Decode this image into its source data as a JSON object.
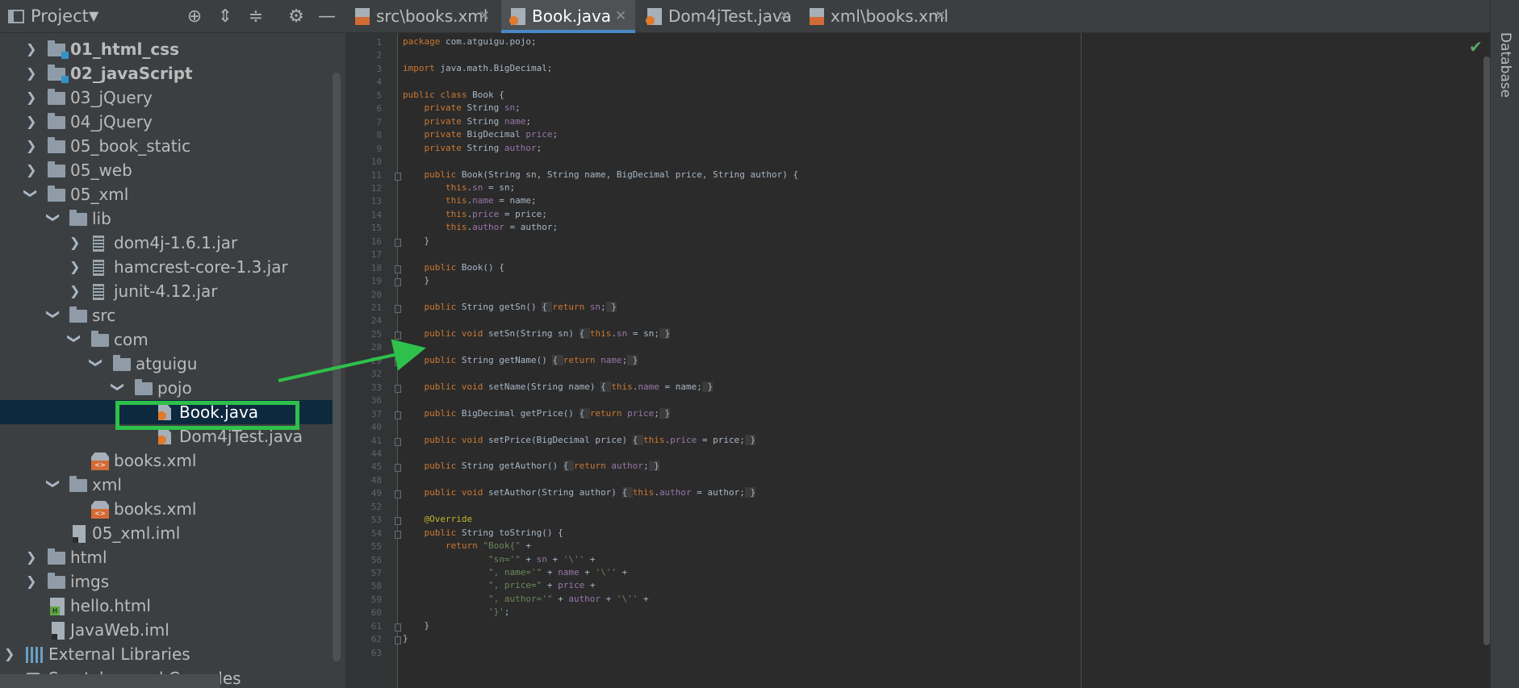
{
  "project_panel": {
    "title": "Project",
    "dropdown_glyph": "▼",
    "tools": [
      "locate-icon",
      "expand-all-icon",
      "collapse-all-icon",
      "gear-icon",
      "minimize-icon"
    ],
    "tree": [
      {
        "label": "01_html_css",
        "bold": true
      },
      {
        "label": "02_javaScript",
        "bold": true
      },
      {
        "label": "03_jQuery"
      },
      {
        "label": "04_jQuery"
      },
      {
        "label": "05_book_static"
      },
      {
        "label": "05_web"
      },
      {
        "label": "05_xml"
      },
      {
        "label": "lib"
      },
      {
        "label": "dom4j-1.6.1.jar"
      },
      {
        "label": "hamcrest-core-1.3.jar"
      },
      {
        "label": "junit-4.12.jar"
      },
      {
        "label": "src"
      },
      {
        "label": "com"
      },
      {
        "label": "atguigu"
      },
      {
        "label": "pojo"
      },
      {
        "label": "Book.java",
        "selected": true
      },
      {
        "label": "Dom4jTest.java"
      },
      {
        "label": "books.xml"
      },
      {
        "label": "xml"
      },
      {
        "label": "books.xml"
      },
      {
        "label": "05_xml.iml"
      },
      {
        "label": "html"
      },
      {
        "label": "imgs"
      },
      {
        "label": "hello.html"
      },
      {
        "label": "JavaWeb.iml"
      },
      {
        "label": "External Libraries"
      },
      {
        "label": "Scratches and Consoles"
      }
    ]
  },
  "tabs": [
    {
      "label": "src\\books.xml",
      "close": "✕"
    },
    {
      "label": "Book.java",
      "close": "✕",
      "active": true
    },
    {
      "label": "Dom4jTest.java",
      "close": "✕"
    },
    {
      "label": "xml\\books.xml",
      "close": "✕"
    }
  ],
  "right_strip": {
    "label": "Database"
  },
  "editor": {
    "status_icon": "✔",
    "line_numbers": [
      "1",
      "2",
      "3",
      "4",
      "5",
      "6",
      "7",
      "8",
      "9",
      "10",
      "11",
      "12",
      "13",
      "14",
      "15",
      "16",
      "17",
      "18",
      "19",
      "20",
      "21",
      "24",
      "25",
      "28",
      "29",
      "32",
      "33",
      "36",
      "37",
      "40",
      "41",
      "44",
      "45",
      "48",
      "49",
      "52",
      "53",
      "54",
      "55",
      "56",
      "57",
      "58",
      "59",
      "60",
      "61",
      "62",
      "63"
    ],
    "lines": [
      {
        "p": [
          [
            "kw",
            "package "
          ],
          [
            "",
            "com.atguigu.pojo;"
          ]
        ]
      },
      {
        "p": []
      },
      {
        "p": [
          [
            "kw",
            "import "
          ],
          [
            "",
            "java.math.BigDecimal;"
          ]
        ]
      },
      {
        "p": []
      },
      {
        "p": [
          [
            "kw",
            "public class "
          ],
          [
            "",
            "Book {"
          ]
        ]
      },
      {
        "p": [
          [
            "",
            "    "
          ],
          [
            "kw",
            "private "
          ],
          [
            "",
            "String "
          ],
          [
            "fld",
            "sn"
          ],
          [
            "",
            ";"
          ]
        ]
      },
      {
        "p": [
          [
            "",
            "    "
          ],
          [
            "kw",
            "private "
          ],
          [
            "",
            "String "
          ],
          [
            "fld",
            "name"
          ],
          [
            "",
            ";"
          ]
        ]
      },
      {
        "p": [
          [
            "",
            "    "
          ],
          [
            "kw",
            "private "
          ],
          [
            "",
            "BigDecimal "
          ],
          [
            "fld",
            "price"
          ],
          [
            "",
            ";"
          ]
        ]
      },
      {
        "p": [
          [
            "",
            "    "
          ],
          [
            "kw",
            "private "
          ],
          [
            "",
            "String "
          ],
          [
            "fld",
            "author"
          ],
          [
            "",
            ";"
          ]
        ]
      },
      {
        "p": []
      },
      {
        "p": [
          [
            "",
            "    "
          ],
          [
            "kw",
            "public "
          ],
          [
            "",
            "Book(String sn, String name, BigDecimal price, String author) {"
          ]
        ]
      },
      {
        "p": [
          [
            "",
            "        "
          ],
          [
            "kw",
            "this"
          ],
          [
            "",
            "."
          ],
          [
            "fld",
            "sn"
          ],
          [
            "",
            " = sn;"
          ]
        ]
      },
      {
        "p": [
          [
            "",
            "        "
          ],
          [
            "kw",
            "this"
          ],
          [
            "",
            "."
          ],
          [
            "fld",
            "name"
          ],
          [
            "",
            " = name;"
          ]
        ]
      },
      {
        "p": [
          [
            "",
            "        "
          ],
          [
            "kw",
            "this"
          ],
          [
            "",
            "."
          ],
          [
            "fld",
            "price"
          ],
          [
            "",
            " = price;"
          ]
        ]
      },
      {
        "p": [
          [
            "",
            "        "
          ],
          [
            "kw",
            "this"
          ],
          [
            "",
            "."
          ],
          [
            "fld",
            "author"
          ],
          [
            "",
            " = author;"
          ]
        ]
      },
      {
        "p": [
          [
            "",
            "    }"
          ]
        ]
      },
      {
        "p": []
      },
      {
        "p": [
          [
            "",
            "    "
          ],
          [
            "kw",
            "public "
          ],
          [
            "",
            "Book() {"
          ]
        ]
      },
      {
        "p": [
          [
            "",
            "    }"
          ]
        ]
      },
      {
        "p": []
      },
      {
        "p": [
          [
            "",
            "    "
          ],
          [
            "kw",
            "public "
          ],
          [
            "",
            "String getSn() "
          ],
          [
            "fold-bg",
            "{ "
          ],
          [
            "kw",
            "return "
          ],
          [
            "fld",
            "sn"
          ],
          [
            "",
            ";"
          ],
          [
            "fold-bg",
            " }"
          ]
        ]
      },
      {
        "p": []
      },
      {
        "p": [
          [
            "",
            "    "
          ],
          [
            "kw",
            "public void "
          ],
          [
            "",
            "setSn(String sn) "
          ],
          [
            "fold-bg",
            "{ "
          ],
          [
            "kw",
            "this"
          ],
          [
            "",
            "."
          ],
          [
            "fld",
            "sn"
          ],
          [
            "",
            " = sn;"
          ],
          [
            "fold-bg",
            " }"
          ]
        ]
      },
      {
        "p": []
      },
      {
        "p": [
          [
            "",
            "    "
          ],
          [
            "kw",
            "public "
          ],
          [
            "",
            "String getName() "
          ],
          [
            "fold-bg",
            "{ "
          ],
          [
            "kw",
            "return "
          ],
          [
            "fld",
            "name"
          ],
          [
            "",
            ";"
          ],
          [
            "fold-bg",
            " }"
          ]
        ]
      },
      {
        "p": []
      },
      {
        "p": [
          [
            "",
            "    "
          ],
          [
            "kw",
            "public void "
          ],
          [
            "",
            "setName(String name) "
          ],
          [
            "fold-bg",
            "{ "
          ],
          [
            "kw",
            "this"
          ],
          [
            "",
            "."
          ],
          [
            "fld",
            "name"
          ],
          [
            "",
            " = name;"
          ],
          [
            "fold-bg",
            " }"
          ]
        ]
      },
      {
        "p": []
      },
      {
        "p": [
          [
            "",
            "    "
          ],
          [
            "kw",
            "public "
          ],
          [
            "",
            "BigDecimal getPrice() "
          ],
          [
            "fold-bg",
            "{ "
          ],
          [
            "kw",
            "return "
          ],
          [
            "fld",
            "price"
          ],
          [
            "",
            ";"
          ],
          [
            "fold-bg",
            " }"
          ]
        ]
      },
      {
        "p": []
      },
      {
        "p": [
          [
            "",
            "    "
          ],
          [
            "kw",
            "public void "
          ],
          [
            "",
            "setPrice(BigDecimal price) "
          ],
          [
            "fold-bg",
            "{ "
          ],
          [
            "kw",
            "this"
          ],
          [
            "",
            "."
          ],
          [
            "fld",
            "price"
          ],
          [
            "",
            " = price;"
          ],
          [
            "fold-bg",
            " }"
          ]
        ]
      },
      {
        "p": []
      },
      {
        "p": [
          [
            "",
            "    "
          ],
          [
            "kw",
            "public "
          ],
          [
            "",
            "String getAuthor() "
          ],
          [
            "fold-bg",
            "{ "
          ],
          [
            "kw",
            "return "
          ],
          [
            "fld",
            "author"
          ],
          [
            "",
            ";"
          ],
          [
            "fold-bg",
            " }"
          ]
        ]
      },
      {
        "p": []
      },
      {
        "p": [
          [
            "",
            "    "
          ],
          [
            "kw",
            "public void "
          ],
          [
            "",
            "setAuthor(String author) "
          ],
          [
            "fold-bg",
            "{ "
          ],
          [
            "kw",
            "this"
          ],
          [
            "",
            "."
          ],
          [
            "fld",
            "author"
          ],
          [
            "",
            " = author;"
          ],
          [
            "fold-bg",
            " }"
          ]
        ]
      },
      {
        "p": []
      },
      {
        "p": [
          [
            "",
            "    "
          ],
          [
            "ann",
            "@Override"
          ]
        ]
      },
      {
        "p": [
          [
            "",
            "    "
          ],
          [
            "kw",
            "public "
          ],
          [
            "",
            "String toString() {"
          ]
        ]
      },
      {
        "p": [
          [
            "",
            "        "
          ],
          [
            "kw",
            "return "
          ],
          [
            "str",
            "\"Book{\" "
          ],
          [
            "",
            "+"
          ]
        ]
      },
      {
        "p": [
          [
            "",
            "                "
          ],
          [
            "str",
            "\"sn='\" "
          ],
          [
            "",
            "+ "
          ],
          [
            "fld",
            "sn "
          ],
          [
            "",
            "+ "
          ],
          [
            "str",
            "'\\'' "
          ],
          [
            "",
            "+"
          ]
        ]
      },
      {
        "p": [
          [
            "",
            "                "
          ],
          [
            "str",
            "\", name='\" "
          ],
          [
            "",
            "+ "
          ],
          [
            "fld",
            "name "
          ],
          [
            "",
            "+ "
          ],
          [
            "str",
            "'\\'' "
          ],
          [
            "",
            "+"
          ]
        ]
      },
      {
        "p": [
          [
            "",
            "                "
          ],
          [
            "str",
            "\", price=\" "
          ],
          [
            "",
            "+ "
          ],
          [
            "fld",
            "price "
          ],
          [
            "",
            "+"
          ]
        ]
      },
      {
        "p": [
          [
            "",
            "                "
          ],
          [
            "str",
            "\", author='\" "
          ],
          [
            "",
            "+ "
          ],
          [
            "fld",
            "author "
          ],
          [
            "",
            "+ "
          ],
          [
            "str",
            "'\\'' "
          ],
          [
            "",
            "+"
          ]
        ]
      },
      {
        "p": [
          [
            "",
            "                "
          ],
          [
            "str",
            "'}'"
          ],
          [
            "",
            ";"
          ]
        ]
      },
      {
        "p": [
          [
            "",
            "    }"
          ]
        ]
      },
      {
        "p": [
          [
            "",
            "}"
          ]
        ]
      },
      {
        "p": []
      }
    ]
  },
  "colors": {
    "accent": "#4a88c7",
    "annotation": "#2ec04a",
    "keyword": "#cc7832",
    "field": "#9876aa",
    "string": "#6a8759"
  }
}
